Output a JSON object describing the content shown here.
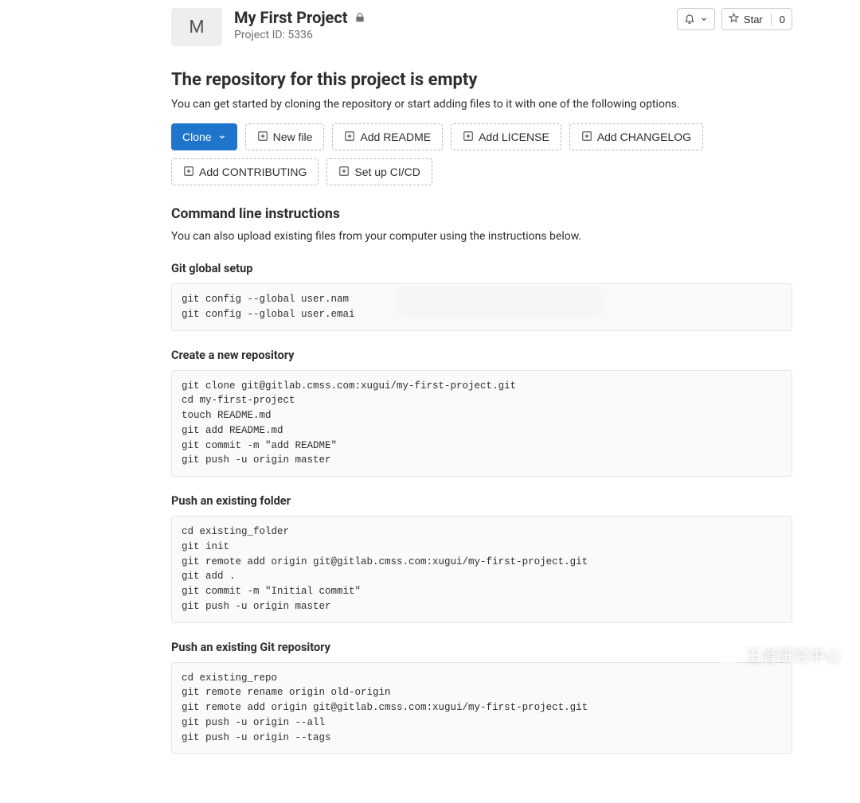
{
  "project": {
    "avatar_letter": "M",
    "title": "My First Project",
    "id_line": "Project ID: 5336"
  },
  "header_actions": {
    "star_label": "Star",
    "star_count": "0"
  },
  "empty": {
    "heading": "The repository for this project is empty",
    "subtext": "You can get started by cloning the repository or start adding files to it with one of the following options."
  },
  "buttons": {
    "clone": "Clone",
    "new_file": "New file",
    "add_readme": "Add README",
    "add_license": "Add LICENSE",
    "add_changelog": "Add CHANGELOG",
    "add_contributing": "Add CONTRIBUTING",
    "setup_cicd": "Set up CI/CD"
  },
  "cli": {
    "heading": "Command line instructions",
    "subtext": "You can also upload existing files from your computer using the instructions below.",
    "global_setup_title": "Git global setup",
    "global_setup_code": "git config --global user.nam\ngit config --global user.emai",
    "create_repo_title": "Create a new repository",
    "create_repo_code": "git clone git@gitlab.cmss.com:xugui/my-first-project.git\ncd my-first-project\ntouch README.md\ngit add README.md\ngit commit -m \"add README\"\ngit push -u origin master",
    "push_folder_title": "Push an existing folder",
    "push_folder_code": "cd existing_folder\ngit init\ngit remote add origin git@gitlab.cmss.com:xugui/my-first-project.git\ngit add .\ngit commit -m \"Initial commit\"\ngit push -u origin master",
    "push_git_title": "Push an existing Git repository",
    "push_git_code": "cd existing_repo\ngit remote rename origin old-origin\ngit remote add origin git@gitlab.cmss.com:xugui/my-first-project.git\ngit push -u origin --all\ngit push -u origin --tags"
  },
  "watermark": "王者研究中心"
}
